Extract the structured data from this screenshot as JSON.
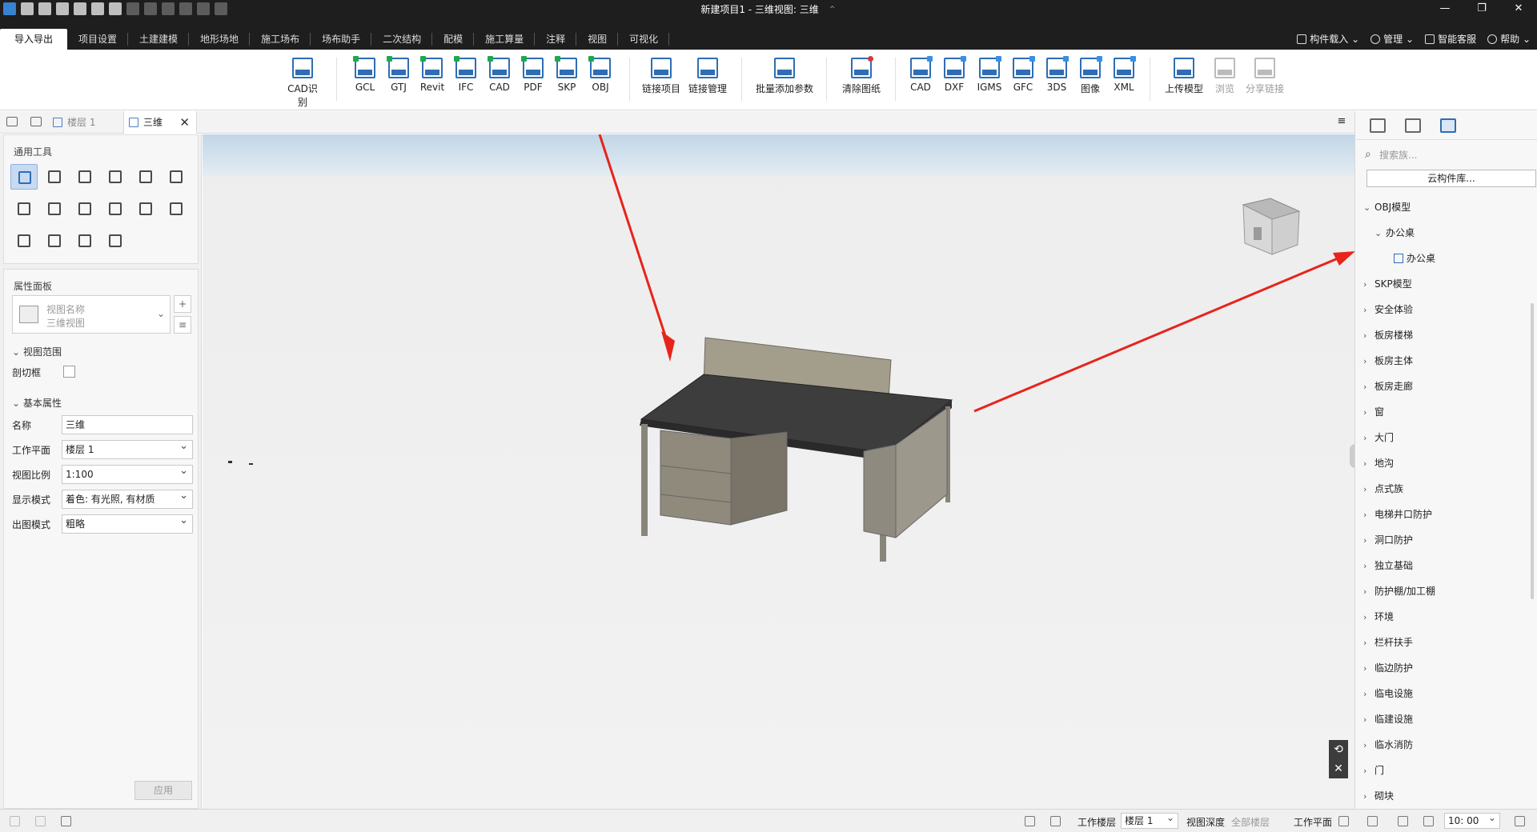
{
  "window": {
    "title": "新建项目1 - 三维视图: 三维",
    "title_chevron": "⌃",
    "controls": [
      "—",
      "❐",
      "✕"
    ]
  },
  "menu": {
    "tabs": [
      "导入导出",
      "项目设置",
      "土建建模",
      "地形场地",
      "施工场布",
      "场布助手",
      "二次结构",
      "配模",
      "施工算量",
      "注释",
      "视图",
      "可视化"
    ],
    "active_tab": "导入导出",
    "right": {
      "component_load": "构件载入",
      "manage": "管理",
      "support": "智能客服",
      "help": "帮助",
      "chevron": "⌄"
    }
  },
  "ribbon": {
    "import_buttons": [
      {
        "label": "CAD识别",
        "badge": "CAD"
      },
      {
        "label": "GCL",
        "badge": "GCL"
      },
      {
        "label": "GTJ",
        "badge": "GTJ"
      },
      {
        "label": "Revit",
        "badge": "GFC"
      },
      {
        "label": "IFC",
        "badge": "IFC"
      },
      {
        "label": "CAD",
        "badge": "CAD"
      },
      {
        "label": "PDF",
        "badge": "PDF"
      },
      {
        "label": "SKP",
        "badge": "SKP"
      },
      {
        "label": "OBJ",
        "badge": "OBJ"
      }
    ],
    "link_buttons": [
      {
        "label": "链接项目",
        "badge": "GBP"
      },
      {
        "label": "链接管理",
        "badge": ""
      }
    ],
    "batch_button": {
      "label": "批量添加参数"
    },
    "clear_button": {
      "label": "清除图纸",
      "badge": "CAD"
    },
    "export_buttons": [
      {
        "label": "CAD",
        "badge": "CAD"
      },
      {
        "label": "DXF",
        "badge": "DXF"
      },
      {
        "label": "IGMS",
        "badge": "IGMS"
      },
      {
        "label": "GFC",
        "badge": "GFC"
      },
      {
        "label": "3DS",
        "badge": "3DS"
      },
      {
        "label": "图像",
        "badge": "PNG"
      },
      {
        "label": "XML",
        "badge": "XML"
      }
    ],
    "cloud_buttons": [
      {
        "label": "上传模型",
        "enabled": true
      },
      {
        "label": "浏览",
        "enabled": false
      },
      {
        "label": "分享链接",
        "enabled": false
      }
    ]
  },
  "view_tabs": [
    {
      "label": "楼层 1",
      "active": false
    },
    {
      "label": "三维",
      "active": true,
      "close": "✕"
    }
  ],
  "view_menu": "≡",
  "tools_panel": {
    "title": "通用工具"
  },
  "props_panel": {
    "title": "属性面板",
    "view_name_label": "视图名称",
    "view_name_value": "三维视图",
    "add": "+",
    "list": "≡",
    "section_view_range": "视图范围",
    "section_basic": "基本属性",
    "crop_box_label": "剖切框",
    "rows": [
      {
        "label": "名称",
        "value": "三维",
        "select": false
      },
      {
        "label": "工作平面",
        "value": "楼层 1",
        "select": true
      },
      {
        "label": "视图比例",
        "value": "1:100",
        "select": true
      },
      {
        "label": "显示模式",
        "value": "着色: 有光照, 有材质",
        "select": true
      },
      {
        "label": "出图模式",
        "value": "粗略",
        "select": true
      }
    ],
    "apply": "应用"
  },
  "right_panel": {
    "search_placeholder": "搜索族...",
    "cloud_library": "云构件库...",
    "tree": [
      {
        "label": "OBJ模型",
        "level": 0,
        "arrow": "⌄"
      },
      {
        "label": "办公桌",
        "level": 1,
        "arrow": "⌄"
      },
      {
        "label": "办公桌",
        "level": 2,
        "arrow": ""
      },
      {
        "label": "SKP模型",
        "level": 0,
        "arrow": "›"
      },
      {
        "label": "安全体验",
        "level": 0,
        "arrow": "›"
      },
      {
        "label": "板房楼梯",
        "level": 0,
        "arrow": "›"
      },
      {
        "label": "板房主体",
        "level": 0,
        "arrow": "›"
      },
      {
        "label": "板房走廊",
        "level": 0,
        "arrow": "›"
      },
      {
        "label": "窗",
        "level": 0,
        "arrow": "›"
      },
      {
        "label": "大门",
        "level": 0,
        "arrow": "›"
      },
      {
        "label": "地沟",
        "level": 0,
        "arrow": "›"
      },
      {
        "label": "点式族",
        "level": 0,
        "arrow": "›"
      },
      {
        "label": "电梯井口防护",
        "level": 0,
        "arrow": "›"
      },
      {
        "label": "洞口防护",
        "level": 0,
        "arrow": "›"
      },
      {
        "label": "独立基础",
        "level": 0,
        "arrow": "›"
      },
      {
        "label": "防护棚/加工棚",
        "level": 0,
        "arrow": "›"
      },
      {
        "label": "环境",
        "level": 0,
        "arrow": "›"
      },
      {
        "label": "栏杆扶手",
        "level": 0,
        "arrow": "›"
      },
      {
        "label": "临边防护",
        "level": 0,
        "arrow": "›"
      },
      {
        "label": "临电设施",
        "level": 0,
        "arrow": "›"
      },
      {
        "label": "临建设施",
        "level": 0,
        "arrow": "›"
      },
      {
        "label": "临水消防",
        "level": 0,
        "arrow": "›"
      },
      {
        "label": "门",
        "level": 0,
        "arrow": "›"
      },
      {
        "label": "砌块",
        "level": 0,
        "arrow": "›"
      }
    ]
  },
  "viewport": {
    "rotate_icon": "⟲",
    "close_icon": "✕",
    "annotation_color": "#e8231b"
  },
  "statusbar": {
    "work_floor_label": "工作楼层",
    "work_floor_value": "楼层 1",
    "view_depth_label": "视图深度",
    "view_depth_value": "全部楼层",
    "work_plane_label": "工作平面",
    "time_value": "10: 00"
  }
}
